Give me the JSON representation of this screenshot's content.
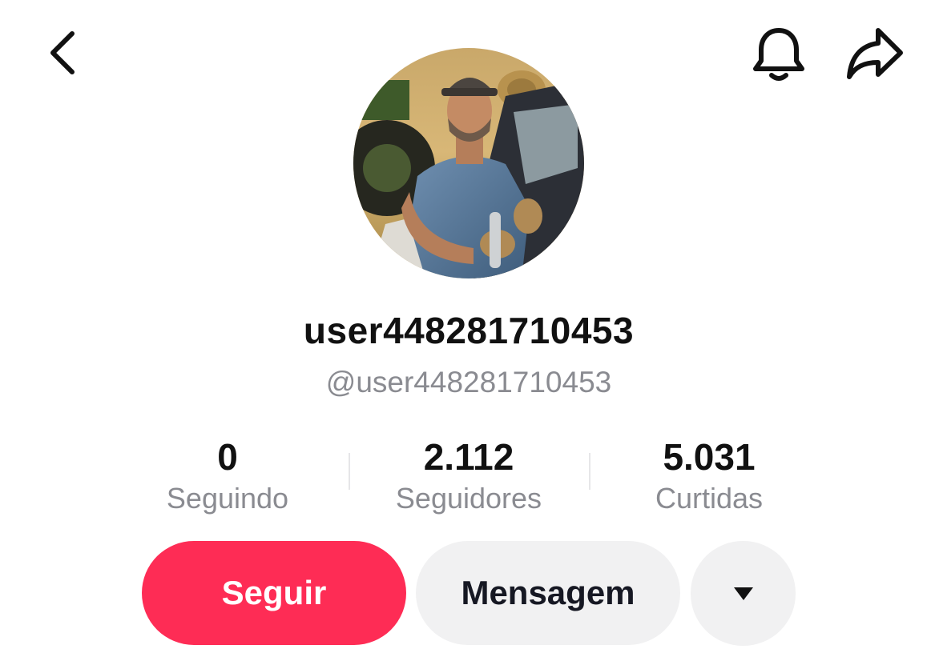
{
  "profile": {
    "display_name": "user448281710453",
    "handle": "@user448281710453"
  },
  "stats": [
    {
      "value": "0",
      "label": "Seguindo"
    },
    {
      "value": "2.112",
      "label": "Seguidores"
    },
    {
      "value": "5.031",
      "label": "Curtidas"
    }
  ],
  "actions": {
    "follow_label": "Seguir",
    "message_label": "Mensagem"
  },
  "icons": {
    "back": "chevron-left-icon",
    "notifications": "bell-icon",
    "share": "share-arrow-icon",
    "more": "caret-down-icon"
  },
  "colors": {
    "primary": "#fe2c55",
    "secondary_button": "#f1f1f2",
    "muted_text": "#8a8b91"
  }
}
